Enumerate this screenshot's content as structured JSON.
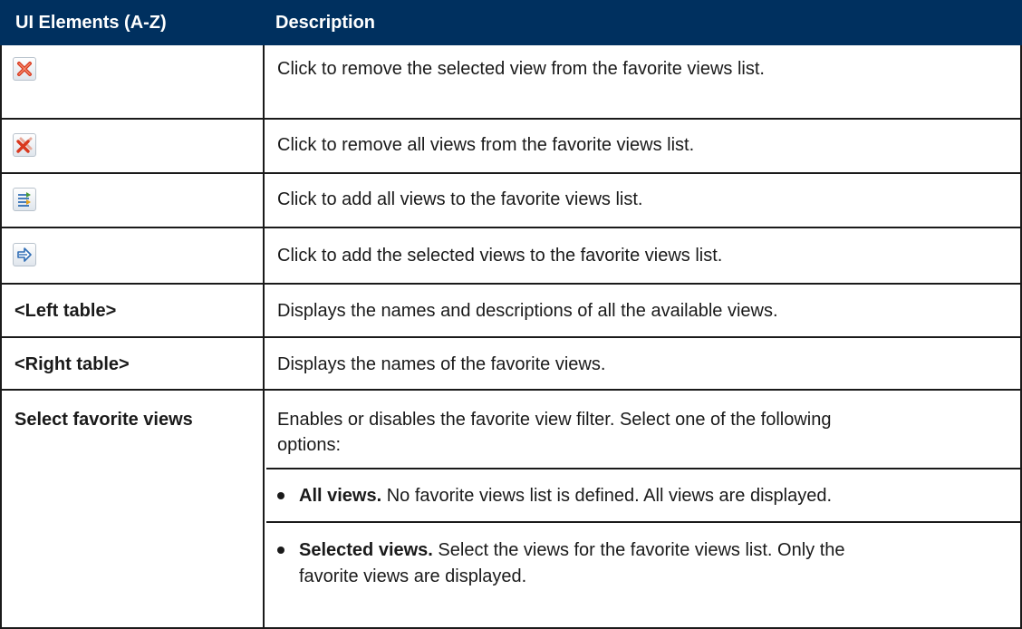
{
  "header": {
    "col1": "UI Elements (A-Z)",
    "col2": "Description"
  },
  "rows": [
    {
      "icon": "remove-selected-icon",
      "description": "Click to remove the selected view from the favorite views list."
    },
    {
      "icon": "remove-all-icon",
      "description": "Click to remove all views from the favorite views list."
    },
    {
      "icon": "add-all-icon",
      "description": "Click to add all views to the favorite views list."
    },
    {
      "icon": "add-selected-icon",
      "description": "Click to add the selected views to the favorite views list."
    },
    {
      "label": "<Left table>",
      "description": "Displays the names and descriptions of all the available views."
    },
    {
      "label": "<Right table>",
      "description": "Displays the names of the favorite views."
    },
    {
      "label": "Select favorite views",
      "description_line1": "Enables or disables the favorite view filter. Select one of the following",
      "description_line2": "options:",
      "options": [
        {
          "name": "All views.",
          "text": " No favorite views list is defined. All views are displayed."
        },
        {
          "name": "Selected views.",
          "text_line1": " Select the views for the favorite views list. Only the",
          "text_line2": "favorite views are displayed."
        }
      ]
    }
  ],
  "colors": {
    "header_bg": "#00305f",
    "header_text": "#ffffff",
    "remove_icon": "#d9381e",
    "add_icon": "#2f6db5"
  }
}
